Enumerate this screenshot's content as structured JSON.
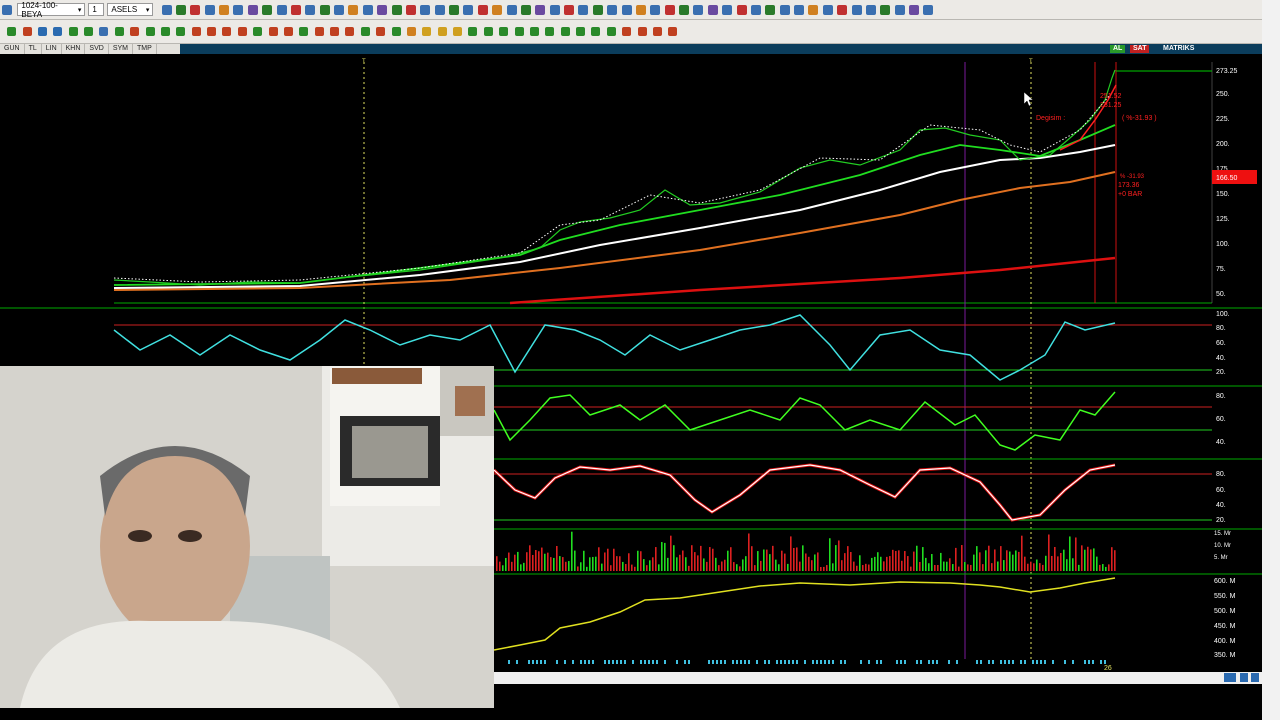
{
  "toolbar": {
    "template_select": "1024-100-BEYA",
    "window_number": "1",
    "symbol": "ASELS",
    "icon_colors_row1": [
      "#3a6fb0",
      "#2a7a2a",
      "#c03030",
      "#3a6fb0",
      "#d08020",
      "#3a6fb0",
      "#6a4aa0",
      "#2a7a2a",
      "#3a6fb0",
      "#c03030",
      "#3a6fb0",
      "#2a7a2a",
      "#3a6fb0",
      "#d08020",
      "#3a6fb0",
      "#6a4aa0",
      "#2a7a2a",
      "#c03030",
      "#3a6fb0",
      "#3a6fb0",
      "#2a7a2a",
      "#3a6fb0",
      "#c03030",
      "#d08020",
      "#3a6fb0",
      "#2a7a2a",
      "#6a4aa0",
      "#3a6fb0",
      "#c03030",
      "#3a6fb0",
      "#2a7a2a",
      "#3a6fb0",
      "#3a6fb0",
      "#d08020",
      "#3a6fb0",
      "#c03030",
      "#2a7a2a",
      "#3a6fb0",
      "#6a4aa0",
      "#3a6fb0",
      "#c03030",
      "#3a6fb0",
      "#2a7a2a",
      "#3a6fb0",
      "#3a6fb0",
      "#d08020",
      "#3a6fb0",
      "#c03030",
      "#3a6fb0",
      "#3a6fb0",
      "#2a7a2a",
      "#3a6fb0",
      "#6a4aa0",
      "#3a6fb0"
    ],
    "icon_colors_row2": [
      "#2a8a2a",
      "#c04020",
      "#2a6ab0",
      "#2a6ab0",
      "#2a8a2a",
      "#2a8a2a",
      "#3a6fb0",
      "#2a8a2a",
      "#c04020",
      "#2a8a2a",
      "#2a8a2a",
      "#2a8a2a",
      "#c04020",
      "#c04020",
      "#c04020",
      "#c04020",
      "#2a8a2a",
      "#c04020",
      "#c04020",
      "#2a8a2a",
      "#c04020",
      "#c04020",
      "#c04020",
      "#2a8a2a",
      "#c04020",
      "#2a8a2a",
      "#d08020",
      "#d0a020",
      "#d0a020",
      "#d0a020",
      "#2a8a2a",
      "#2a8a2a",
      "#2a8a2a",
      "#2a8a2a",
      "#2a8a2a",
      "#2a8a2a",
      "#2a8a2a",
      "#2a8a2a",
      "#2a8a2a",
      "#2a8a2a",
      "#c04020",
      "#c04020",
      "#c04020",
      "#c04020"
    ]
  },
  "tabs": [
    "GUN",
    "TL",
    "LIN",
    "KHN",
    "SVD",
    "SYM",
    "TMP"
  ],
  "badges": {
    "al": "AL",
    "sat": "SAT",
    "matriks": "MATRIKS"
  },
  "colors": {
    "al": "#2a9a2a",
    "sat": "#c02020",
    "matriks_bg": "#0b3d5c",
    "accent_green": "#00ff00",
    "price_red": "#ff2020"
  },
  "price_axis": [
    "273.25",
    "250.",
    "225.",
    "200.",
    "175.",
    "150.",
    "125.",
    "100.",
    "75.",
    "50."
  ],
  "price_highlight": "166.50",
  "annotations": {
    "top_values": [
      "251.52",
      "231.25"
    ],
    "change_label": "Degisim : ",
    "change_pct": "( %-31.93 )",
    "drop_pct": "% -31.93",
    "drop_value": "173.36",
    "drop_bars": "+0 BAR"
  },
  "rsi_axis": [
    "100.",
    "80.",
    "60.",
    "40.",
    "20."
  ],
  "osc2_axis": [
    "80.",
    "60.",
    "40."
  ],
  "stoch_axis": [
    "80.",
    "60.",
    "40.",
    "20."
  ],
  "volume_axis": [
    "15. Mr",
    "10. Mr",
    "5. Mr"
  ],
  "obv_axis": [
    "600. M",
    "550. M",
    "500. M",
    "450. M",
    "400. M",
    "350. M"
  ],
  "date_label": "26",
  "vline_marker": "T"
}
